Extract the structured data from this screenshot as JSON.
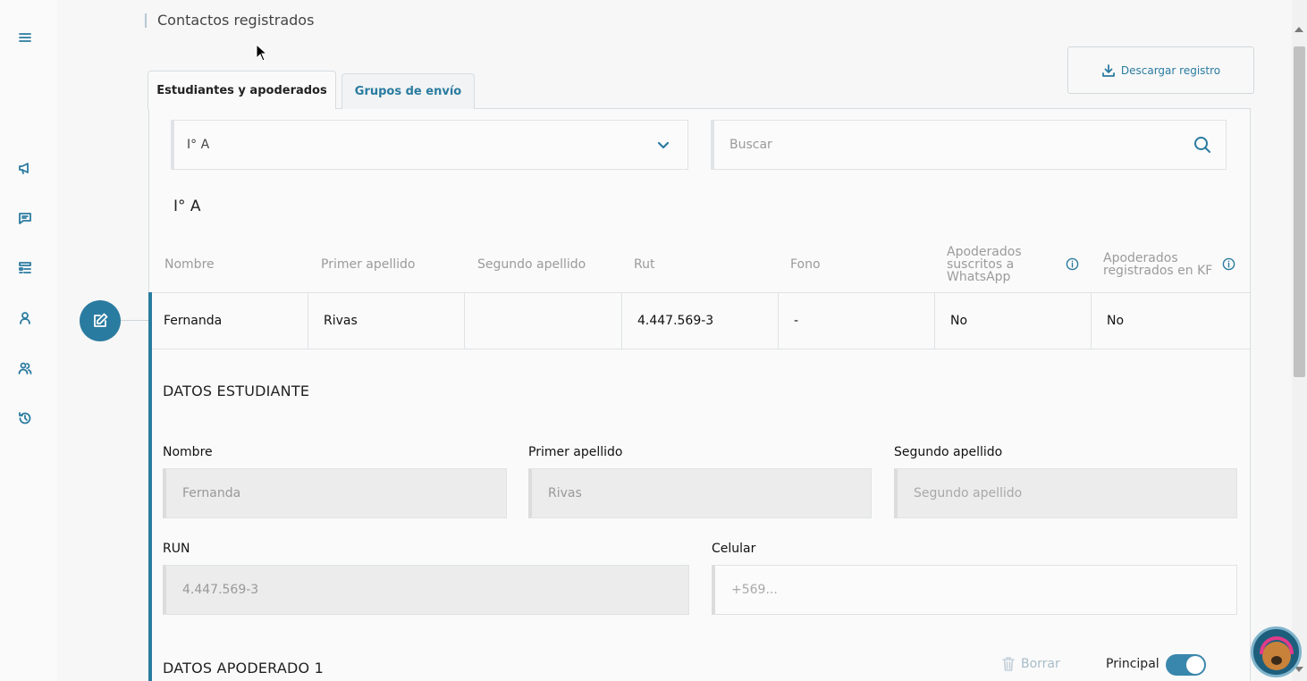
{
  "sidebar": {
    "items": [
      {
        "icon": "menu-icon"
      },
      {
        "icon": "megaphone-icon"
      },
      {
        "icon": "chat-icon"
      },
      {
        "icon": "list-icon"
      },
      {
        "icon": "user-icon"
      },
      {
        "icon": "users-icon"
      },
      {
        "icon": "history-icon"
      }
    ]
  },
  "header": {
    "title": "Contactos registrados",
    "download_label": "Descargar registro"
  },
  "tabs": [
    {
      "label": "Estudiantes y apoderados",
      "active": true
    },
    {
      "label": "Grupos de envío",
      "active": false
    }
  ],
  "filters": {
    "course_selected": "I° A",
    "search_placeholder": "Buscar"
  },
  "course_label": "I° A",
  "table": {
    "headers": [
      "Nombre",
      "Primer apellido",
      "Segundo apellido",
      "Rut",
      "Fono",
      "Apoderados suscritos a WhatsApp",
      "Apoderados registrados en KF"
    ],
    "rows": [
      [
        "Fernanda",
        "Rivas",
        "",
        "4.447.569-3",
        "-",
        "No",
        "No"
      ]
    ]
  },
  "student_form": {
    "title": "DATOS ESTUDIANTE",
    "nombre_label": "Nombre",
    "nombre_value": "Fernanda",
    "primer_apellido_label": "Primer apellido",
    "primer_apellido_value": "Rivas",
    "segundo_apellido_label": "Segundo apellido",
    "segundo_apellido_placeholder": "Segundo apellido",
    "run_label": "RUN",
    "run_value": "4.447.569-3",
    "celular_label": "Celular",
    "celular_placeholder": "+569..."
  },
  "guardian": {
    "title": "DATOS APODERADO 1",
    "delete_label": "Borrar",
    "principal_label": "Principal",
    "principal_on": true
  },
  "colors": {
    "accent": "#2a7ba0",
    "toggle_on": "#3a87ad"
  }
}
